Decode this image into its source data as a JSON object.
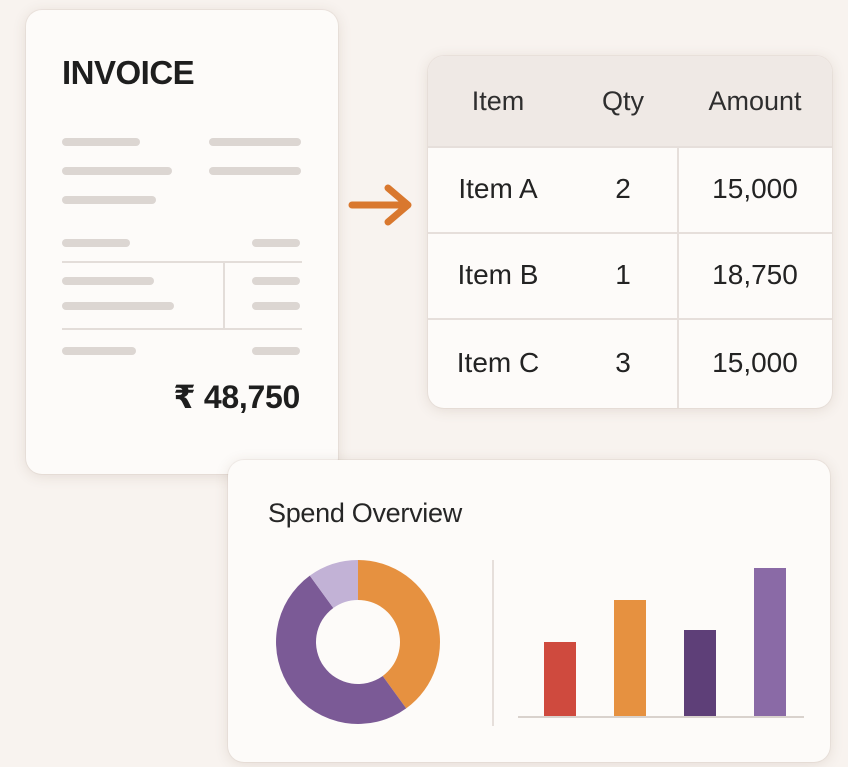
{
  "invoice": {
    "title": "INVOICE",
    "total": "₹ 48,750"
  },
  "table": {
    "headers": {
      "item": "Item",
      "qty": "Qty",
      "amount": "Amount"
    },
    "rows": [
      {
        "item": "Item A",
        "qty": "2",
        "amount": "15,000"
      },
      {
        "item": "Item B",
        "qty": "1",
        "amount": "18,750"
      },
      {
        "item": "Item C",
        "qty": "3",
        "amount": "15,000"
      }
    ]
  },
  "spend": {
    "title": "Spend Overview"
  },
  "colors": {
    "arrow": "#d9782e",
    "orange": "#e69140",
    "purple": "#7b5a96",
    "lavender": "#c2b2d6",
    "red": "#cf4a3e",
    "dark_purple": "#5e3f78",
    "mid_purple": "#8a6aa6"
  },
  "chart_data": [
    {
      "type": "pie",
      "donut": true,
      "slices": [
        {
          "value": 40,
          "color": "#e69140"
        },
        {
          "value": 50,
          "color": "#7b5a96"
        },
        {
          "value": 10,
          "color": "#c2b2d6"
        }
      ]
    },
    {
      "type": "bar",
      "values": [
        37,
        58,
        43,
        74
      ],
      "colors": [
        "#cf4a3e",
        "#e69140",
        "#5e3f78",
        "#8a6aa6"
      ],
      "ylim": [
        0,
        80
      ],
      "grid": false
    }
  ]
}
